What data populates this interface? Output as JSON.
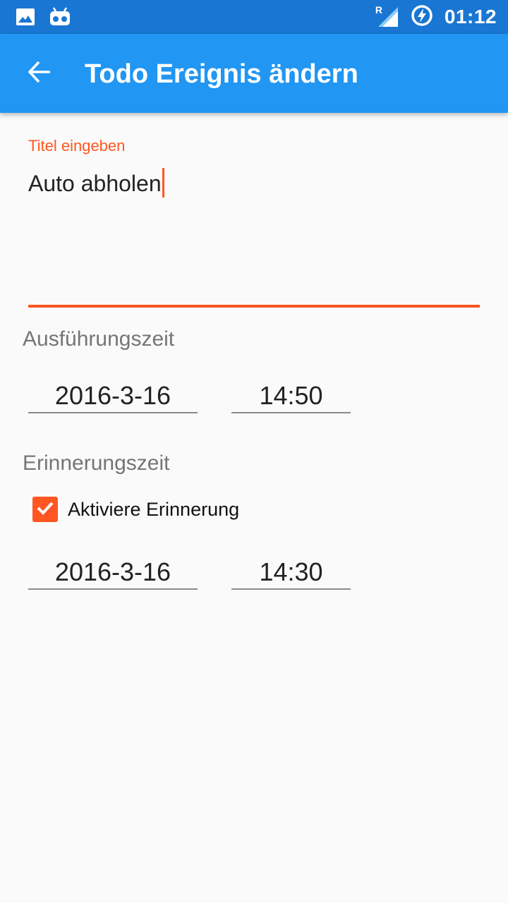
{
  "status_bar": {
    "time": "01:12",
    "network_indicator": "R",
    "icons": [
      "image-icon",
      "android-debug-icon",
      "signal-icon",
      "battery-charging-icon"
    ]
  },
  "app_bar": {
    "title": "Todo Ereignis ändern",
    "back_icon": "arrow-back-icon"
  },
  "form": {
    "title_field": {
      "label": "Titel eingeben",
      "value": "Auto abholen"
    },
    "execution": {
      "label": "Ausführungszeit",
      "date": "2016-3-16",
      "time": "14:50"
    },
    "reminder": {
      "label": "Erinnerungszeit",
      "checkbox_label": "Aktiviere Erinnerung",
      "checked": true,
      "date": "2016-3-16",
      "time": "14:30"
    }
  },
  "colors": {
    "status_bar": "#1976d2",
    "app_bar": "#2196f3",
    "accent": "#ff5722",
    "background": "#fafafa"
  }
}
